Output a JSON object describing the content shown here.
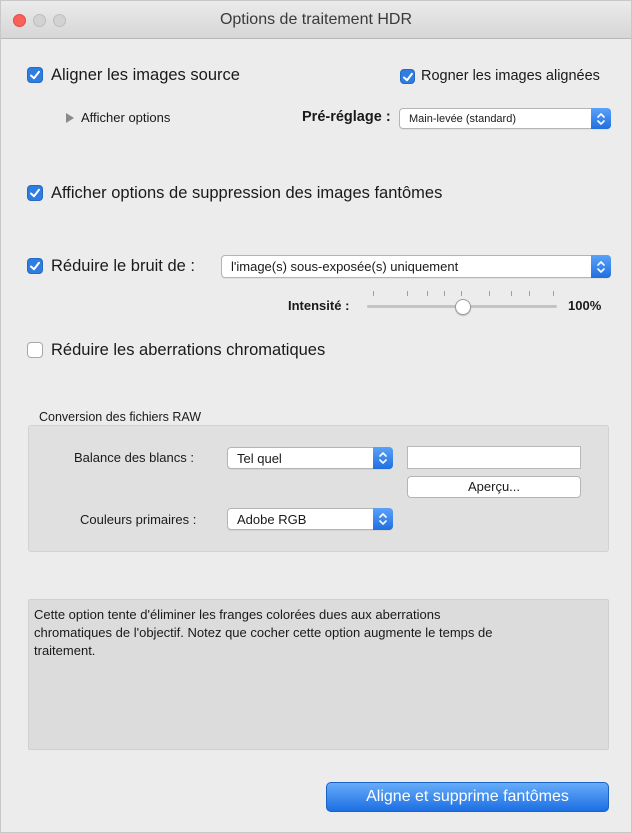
{
  "window": {
    "title": "Options de traitement HDR"
  },
  "align": {
    "label": "Aligner les images source",
    "checked": true,
    "show_options_label": "Afficher options",
    "crop_label": "Rogner les images alignées",
    "crop_checked": true,
    "preset_label": "Pré-réglage :",
    "preset_value": "Main-levée (standard)"
  },
  "ghost": {
    "label": "Afficher options de suppression des images fantômes",
    "checked": true
  },
  "noise": {
    "label": "Réduire le bruit de :",
    "checked": true,
    "source_value": "l'image(s) sous-exposée(s) uniquement",
    "intensity_label": "Intensité :",
    "intensity_value_text": "100%",
    "intensity_level": 1.0
  },
  "chroma": {
    "label": "Réduire les aberrations chromatiques",
    "checked": false
  },
  "raw": {
    "section_title": "Conversion des fichiers RAW",
    "white_balance_label": "Balance des blancs :",
    "white_balance_value": "Tel quel",
    "white_balance_field_value": "",
    "preview_button": "Aperçu...",
    "primaries_label": "Couleurs primaires :",
    "primaries_value": "Adobe RGB"
  },
  "description": {
    "line1": "Cette option tente d'éliminer les franges colorées dues aux aberrations",
    "line2": "chromatiques de l'objectif. Notez que cocher cette option augmente le temps de",
    "line3": "traitement."
  },
  "footer": {
    "primary_button": "Aligne et supprime fantômes"
  },
  "icons": {
    "close": "close-icon",
    "minimize": "minimize-icon",
    "zoom": "zoom-icon",
    "check": "checkmark-icon",
    "disclosure": "disclosure-triangle-icon",
    "updown": "updown-chevron-icon"
  },
  "colors": {
    "accent": "#2f7de1",
    "close": "#fc605b"
  }
}
